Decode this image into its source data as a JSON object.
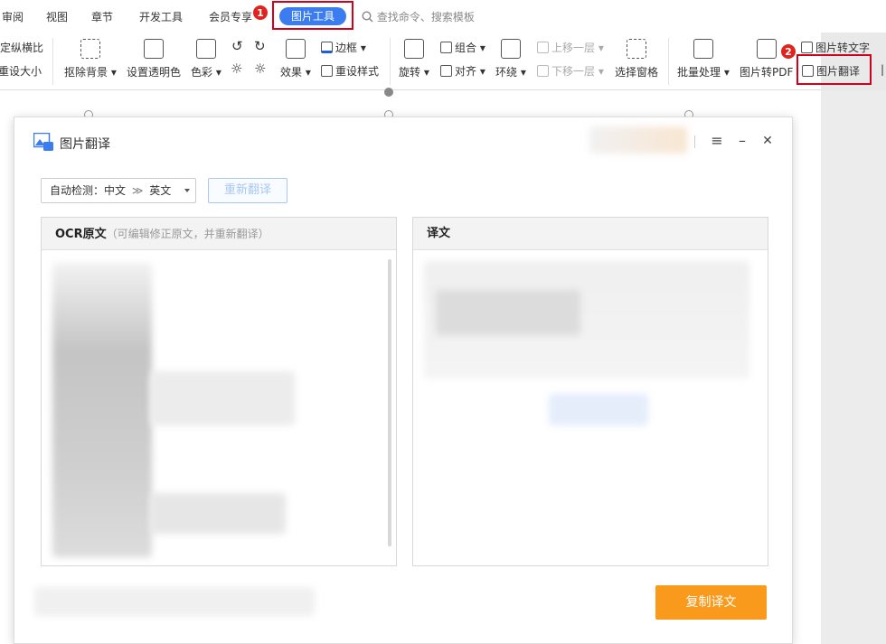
{
  "menubar": {
    "items": [
      "审阅",
      "视图",
      "章节",
      "开发工具",
      "会员专享"
    ],
    "active_tab": "图片工具",
    "search_placeholder": "查找命令、搜索模板"
  },
  "badges": {
    "one": "1",
    "two": "2"
  },
  "ribbon": {
    "lock_ratio": "锁定纵横比",
    "reset_size": "重设大小",
    "remove_bg": "抠除背景",
    "set_transparent": "设置透明色",
    "color": "色彩",
    "effect": "效果",
    "border": "边框",
    "reset_style": "重设样式",
    "rotate": "旋转",
    "group": "组合",
    "align": "对齐",
    "wrap": "环绕",
    "bring_forward": "上移一层",
    "send_backward": "下移一层",
    "selection_pane": "选择窗格",
    "batch": "批量处理",
    "to_pdf": "图片转PDF",
    "to_text": "图片转文字",
    "translate": "图片翻译"
  },
  "dialog": {
    "title": "图片翻译",
    "lang_prefix": "自动检测：",
    "source_lang": "中文",
    "arrow": "≫",
    "target_lang": "英文",
    "retranslate": "重新翻译",
    "ocr_title": "OCR原文",
    "ocr_hint": "（可编辑修正原文，并重新翻译）",
    "translation_title": "译文",
    "copy_button": "复制译文",
    "menu_glyph": "≡",
    "min_glyph": "–",
    "close_glyph": "✕"
  },
  "colors": {
    "accent": "#3b7df0",
    "highlight": "#d0021b",
    "copy": "#fa9a1c"
  }
}
